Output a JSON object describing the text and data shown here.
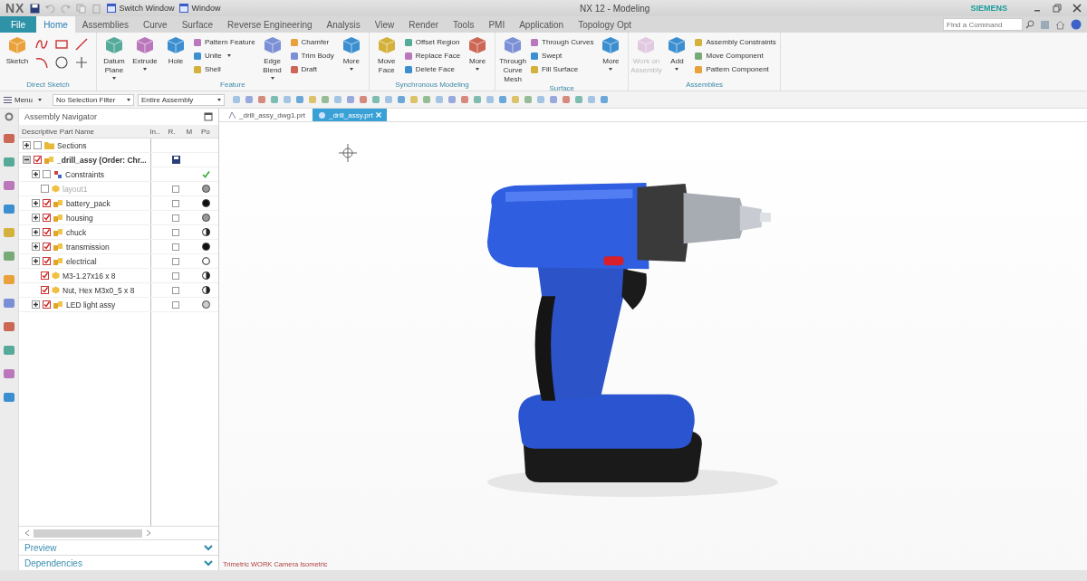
{
  "title_bar": {
    "app": "NX",
    "quick_access": [
      {
        "label": "Switch Window"
      },
      {
        "label": "Window"
      }
    ],
    "title": "NX 12 - Modeling",
    "brand": "SIEMENS"
  },
  "file_menu": "File",
  "tabs": [
    {
      "label": "Home",
      "kind": "tab",
      "selected": true
    },
    {
      "label": "Assemblies",
      "kind": "tab",
      "selected": false
    },
    {
      "label": "Curve",
      "kind": "tab",
      "selected": false
    },
    {
      "label": "Surface",
      "kind": "tab",
      "selected": false
    },
    {
      "label": "Reverse Engineering",
      "kind": "tab",
      "selected": false
    },
    {
      "label": "Analysis",
      "kind": "tab",
      "selected": false
    },
    {
      "label": "View",
      "kind": "tab",
      "selected": false
    },
    {
      "label": "Render",
      "kind": "tab",
      "selected": false
    },
    {
      "label": "Tools",
      "kind": "tab",
      "selected": false
    },
    {
      "label": "PMI",
      "kind": "tab",
      "selected": false
    },
    {
      "label": "Application",
      "kind": "tab",
      "selected": false
    },
    {
      "label": "Topology Opt",
      "kind": "tab",
      "selected": false
    }
  ],
  "search": {
    "placeholder": "Find a Command"
  },
  "ribbon": [
    {
      "label": "Direct Sketch",
      "items": [
        {
          "kind": "large",
          "label": "Sketch",
          "dropdown": false,
          "disabled": false
        },
        {
          "kind": "sketch_grid"
        }
      ]
    },
    {
      "label": "Feature",
      "items": [
        {
          "kind": "large",
          "label": "Datum Plane",
          "dropdown": true,
          "disabled": false
        },
        {
          "kind": "large",
          "label": "Extrude",
          "dropdown": true,
          "disabled": false
        },
        {
          "kind": "large",
          "label": "Hole",
          "dropdown": false,
          "disabled": false
        },
        {
          "kind": "small",
          "label": "Pattern Feature",
          "dropdown": false,
          "disabled": false
        },
        {
          "kind": "small",
          "label": "Unite",
          "dropdown": true,
          "disabled": false
        },
        {
          "kind": "small",
          "label": "Shell",
          "dropdown": false,
          "disabled": false
        },
        {
          "kind": "large",
          "label": "Edge Blend",
          "dropdown": true,
          "disabled": false
        },
        {
          "kind": "small",
          "label": "Chamfer",
          "dropdown": false,
          "disabled": false
        },
        {
          "kind": "small",
          "label": "Trim Body",
          "dropdown": false,
          "disabled": false
        },
        {
          "kind": "small",
          "label": "Draft",
          "dropdown": false,
          "disabled": false
        },
        {
          "kind": "large",
          "label": "More",
          "dropdown": true,
          "disabled": false
        }
      ]
    },
    {
      "label": "Synchronous Modeling",
      "items": [
        {
          "kind": "large",
          "label": "Move Face",
          "dropdown": false,
          "disabled": false
        },
        {
          "kind": "small",
          "label": "Offset Region",
          "dropdown": false,
          "disabled": false
        },
        {
          "kind": "small",
          "label": "Replace Face",
          "dropdown": false,
          "disabled": false
        },
        {
          "kind": "small",
          "label": "Delete Face",
          "dropdown": false,
          "disabled": false
        },
        {
          "kind": "large",
          "label": "More",
          "dropdown": true,
          "disabled": false
        }
      ]
    },
    {
      "label": "Surface",
      "items": [
        {
          "kind": "large",
          "label": "Through Curve Mesh",
          "dropdown": false,
          "disabled": false
        },
        {
          "kind": "small",
          "label": "Through Curves",
          "dropdown": false,
          "disabled": false
        },
        {
          "kind": "small",
          "label": "Swept",
          "dropdown": false,
          "disabled": false
        },
        {
          "kind": "small",
          "label": "Fill Surface",
          "dropdown": false,
          "disabled": false
        },
        {
          "kind": "large",
          "label": "More",
          "dropdown": true,
          "disabled": false
        }
      ]
    },
    {
      "label": "Assemblies",
      "items": [
        {
          "kind": "large",
          "label": "Work on Assembly",
          "dropdown": false,
          "disabled": true
        },
        {
          "kind": "large",
          "label": "Add",
          "dropdown": true,
          "disabled": false
        },
        {
          "kind": "small",
          "label": "Assembly Constraints",
          "dropdown": false,
          "disabled": false
        },
        {
          "kind": "small",
          "label": "Move Component",
          "dropdown": false,
          "disabled": false
        },
        {
          "kind": "small",
          "label": "Pattern Component",
          "dropdown": false,
          "disabled": false
        }
      ]
    }
  ],
  "toolbar": {
    "menu": "Menu",
    "selection_filter": "No Selection Filter",
    "scope": "Entire Assembly"
  },
  "navigator": {
    "title": "Assembly Navigator",
    "columns": [
      "Descriptive Part Name",
      "In..",
      "R.",
      "M",
      "Po"
    ],
    "rows": [
      {
        "name": "Sections",
        "kind": "sections",
        "expanded": false,
        "checked": false,
        "disabled": false,
        "ref_box": false,
        "saved": false
      },
      {
        "name": "_drill_assy (Order: Chr...",
        "kind": "assembly",
        "expanded": true,
        "checked": true,
        "disabled": false,
        "ref_box": false,
        "saved": true,
        "children": [
          {
            "name": "Constraints",
            "kind": "constraints",
            "expanded": false,
            "checked": false,
            "disabled": false,
            "ref_box": false,
            "saved": false,
            "status": {
              "kind": "check"
            }
          },
          {
            "name": "layout1",
            "kind": "part",
            "checked": false,
            "disabled": true,
            "ref_box": true,
            "saved": false,
            "status": {
              "kind": "circle",
              "color": "#999999"
            }
          },
          {
            "name": "battery_pack",
            "kind": "assembly",
            "expanded": false,
            "checked": true,
            "disabled": false,
            "ref_box": true,
            "saved": false,
            "status": {
              "kind": "circle",
              "color": "#111111"
            }
          },
          {
            "name": "housing",
            "kind": "assembly",
            "expanded": false,
            "checked": true,
            "disabled": false,
            "ref_box": true,
            "saved": false,
            "status": {
              "kind": "circle",
              "color": "#999999"
            }
          },
          {
            "name": "chuck",
            "kind": "assembly",
            "expanded": false,
            "checked": true,
            "disabled": false,
            "ref_box": true,
            "saved": false,
            "status": {
              "kind": "half"
            }
          },
          {
            "name": "transmission",
            "kind": "assembly",
            "expanded": false,
            "checked": true,
            "disabled": false,
            "ref_box": true,
            "saved": false,
            "status": {
              "kind": "circle",
              "color": "#111111"
            }
          },
          {
            "name": "electrical",
            "kind": "assembly",
            "expanded": false,
            "checked": true,
            "disabled": false,
            "ref_box": true,
            "saved": false,
            "status": {
              "kind": "ring"
            }
          },
          {
            "name": "M3-1.27x16 x 8",
            "kind": "part",
            "checked": true,
            "disabled": false,
            "ref_box": true,
            "saved": false,
            "status": {
              "kind": "half"
            }
          },
          {
            "name": "Nut, Hex M3x0_5 x 8",
            "kind": "part",
            "checked": true,
            "disabled": false,
            "ref_box": true,
            "saved": false,
            "status": {
              "kind": "half"
            }
          },
          {
            "name": "LED light assy",
            "kind": "assembly",
            "expanded": false,
            "checked": true,
            "disabled": false,
            "ref_box": true,
            "saved": false,
            "status": {
              "kind": "circle",
              "color": "#cccccc"
            }
          }
        ]
      }
    ],
    "panels": [
      {
        "label": "Preview",
        "expanded": false
      },
      {
        "label": "Dependencies",
        "expanded": false
      }
    ]
  },
  "documents": [
    {
      "label": "_drill_assy_dwg1.prt",
      "kind": "drawing",
      "selected": false
    },
    {
      "label": "_drill_assy.prt",
      "kind": "model",
      "selected": true
    }
  ],
  "viewport": {
    "status": "Trimetric WORK Camera Isometric"
  }
}
